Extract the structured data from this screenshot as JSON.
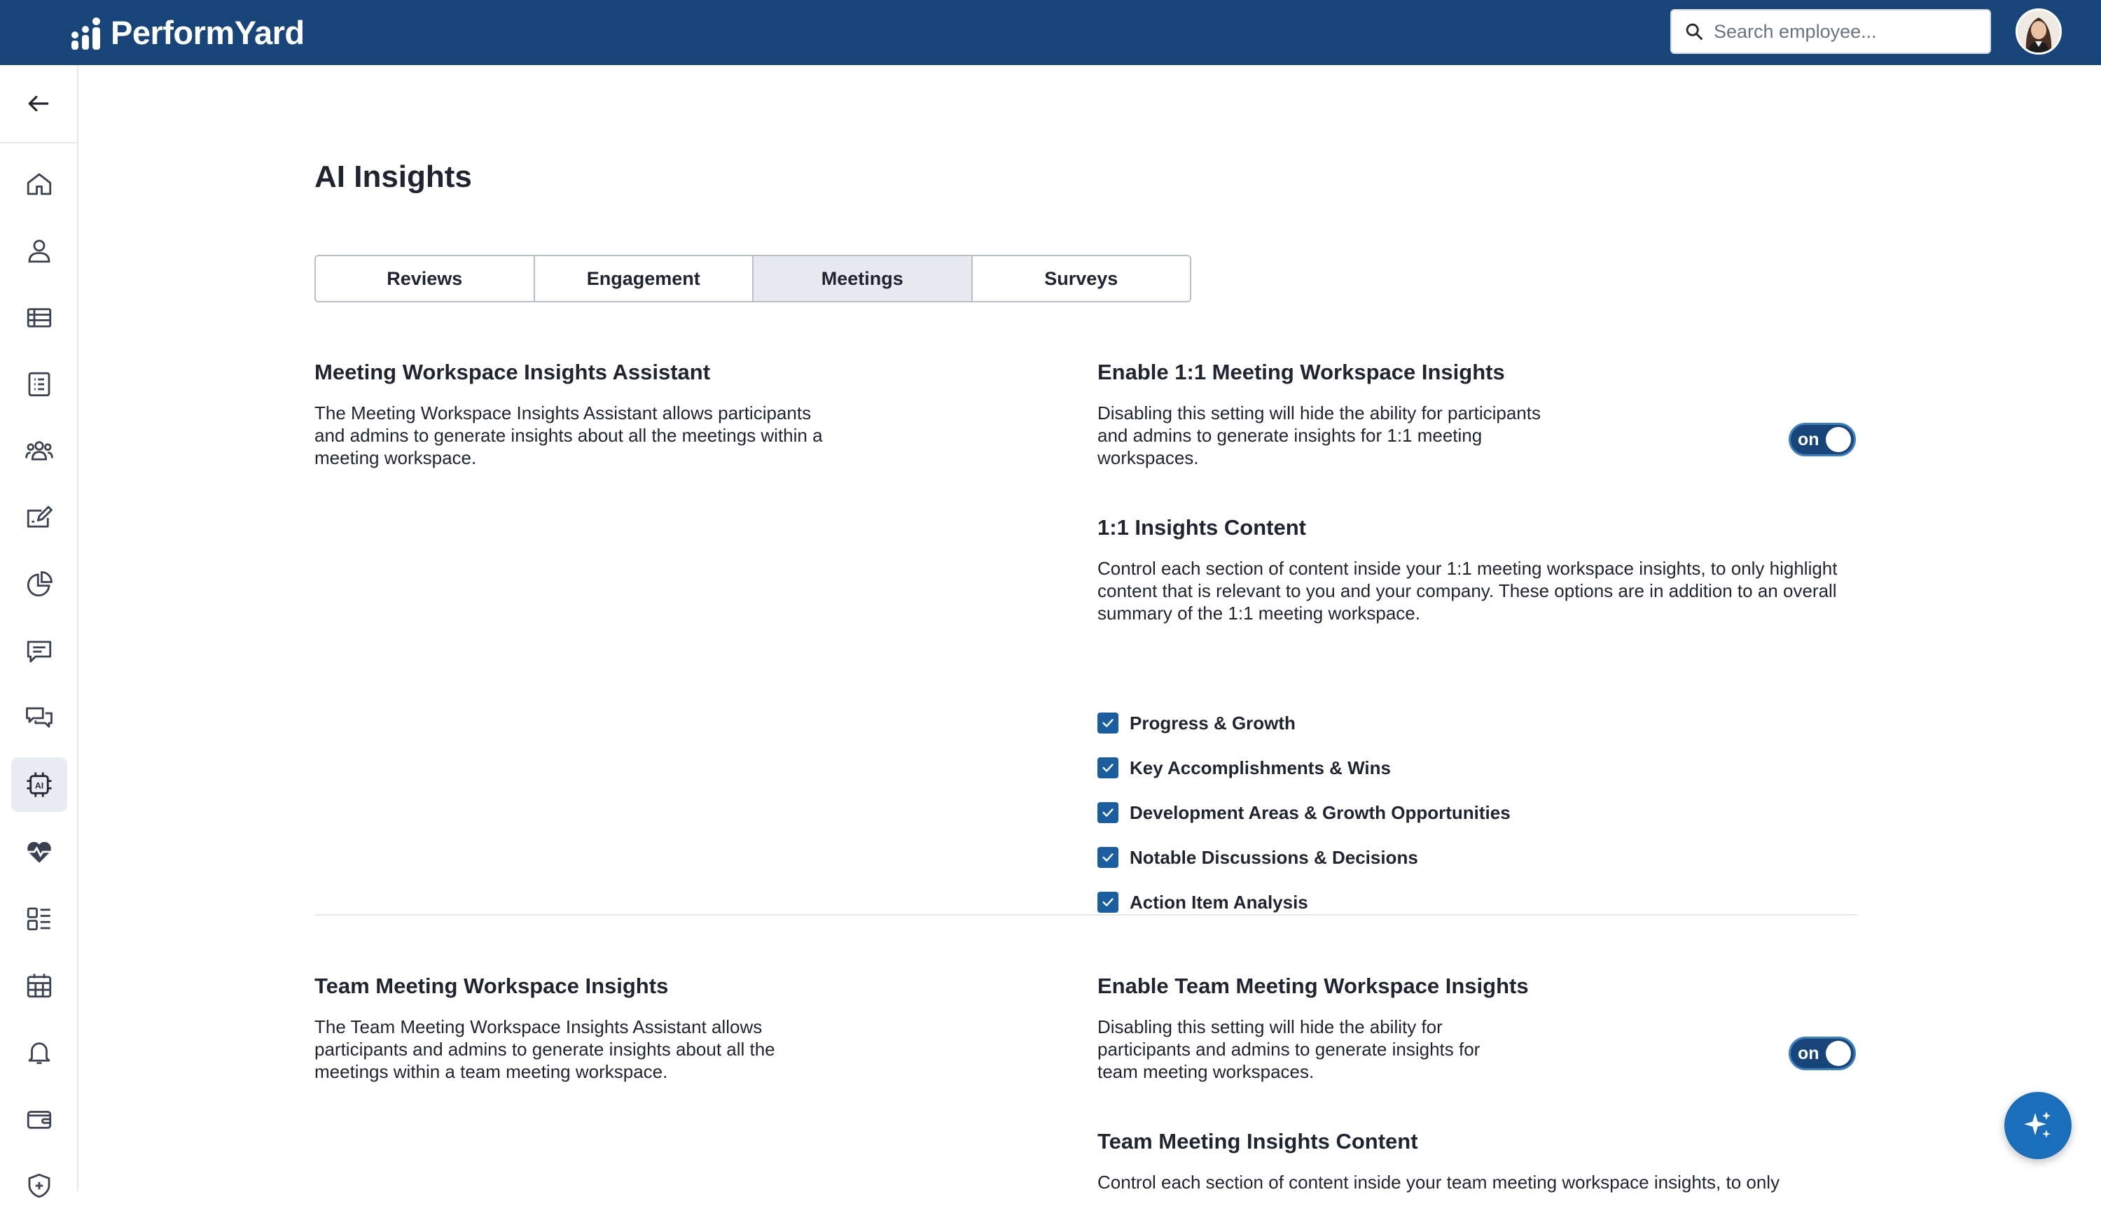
{
  "brand": {
    "name": "PerformYard"
  },
  "header": {
    "search_placeholder": "Search employee..."
  },
  "page": {
    "title": "AI Insights"
  },
  "tabs": [
    {
      "label": "Reviews",
      "active": false
    },
    {
      "label": "Engagement",
      "active": false
    },
    {
      "label": "Meetings",
      "active": true
    },
    {
      "label": "Surveys",
      "active": false
    }
  ],
  "one_on_one": {
    "assistant_title": "Meeting Workspace Insights Assistant",
    "assistant_desc": "The Meeting Workspace Insights Assistant allows participants and admins to generate insights about all the meetings within a meeting workspace.",
    "enable_title": "Enable 1:1 Meeting Workspace Insights",
    "enable_desc": "Disabling this setting will hide the ability for participants and admins to generate insights for 1:1 meeting workspaces.",
    "toggle_label": "on",
    "content_title": "1:1 Insights Content",
    "content_desc": "Control each section of content inside your 1:1 meeting workspace insights, to only highlight content that is relevant to you and your company. These options are in addition to an overall summary of the 1:1 meeting workspace.",
    "options": [
      {
        "label": "Progress & Growth",
        "checked": true
      },
      {
        "label": "Key Accomplishments & Wins",
        "checked": true
      },
      {
        "label": "Development Areas & Growth Opportunities",
        "checked": true
      },
      {
        "label": "Notable Discussions & Decisions",
        "checked": true
      },
      {
        "label": "Action Item Analysis",
        "checked": true
      }
    ]
  },
  "team": {
    "assistant_title": "Team Meeting Workspace Insights",
    "assistant_desc": "The Team Meeting Workspace Insights Assistant allows participants and admins to generate insights about all the meetings within a team meeting workspace.",
    "enable_title": "Enable Team Meeting Workspace Insights",
    "enable_desc": "Disabling this setting will hide the ability for participants and admins to generate insights for team meeting workspaces.",
    "toggle_label": "on",
    "content_title": "Team Meeting Insights Content",
    "content_desc": "Control each section of content inside your team meeting workspace insights, to only"
  },
  "colors": {
    "header_bg": "#17457a",
    "accent": "#1b5ea0",
    "fab": "#1b6fba"
  },
  "sidebar_icons": [
    "back-arrow-icon",
    "home-icon",
    "person-icon",
    "table-icon",
    "list-icon",
    "people-icon",
    "edit-icon",
    "pie-chart-icon",
    "message-icon",
    "chat-icon",
    "ai-chip-icon",
    "heart-pulse-icon",
    "dashboard-icon",
    "calendar-icon",
    "bell-icon",
    "wallet-icon",
    "shield-plus-icon"
  ]
}
